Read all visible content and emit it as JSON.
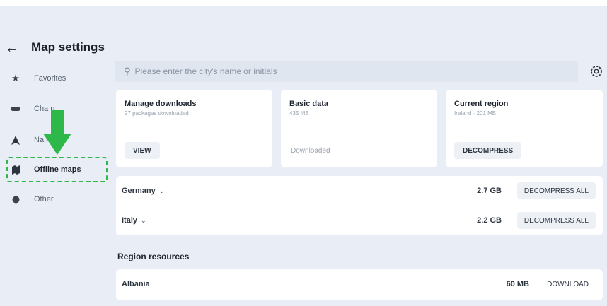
{
  "header": {
    "title": "Map settings"
  },
  "sidebar": {
    "items": [
      {
        "label": "Favorites",
        "icon": "star-icon"
      },
      {
        "label": "Cha  n",
        "icon": "car-icon"
      },
      {
        "label": "Na      n",
        "icon": "navigation-icon"
      },
      {
        "label": "Offline maps",
        "icon": "offline-maps-icon",
        "active": true
      },
      {
        "label": "Other",
        "icon": "dot-icon"
      }
    ]
  },
  "search": {
    "placeholder": "Please enter the city's name or initials"
  },
  "cards": [
    {
      "title": "Manage downloads",
      "subtitle": "27 packages downloaded",
      "button": "VIEW"
    },
    {
      "title": "Basic data",
      "subtitle": "435 MB",
      "status": "Downloaded"
    },
    {
      "title": "Current region",
      "subtitle": "Ireland · 201 MB",
      "button": "DECOMPRESS"
    }
  ],
  "downloaded": [
    {
      "name": "Germany",
      "size": "2.7 GB",
      "action": "DECOMPRESS ALL"
    },
    {
      "name": "Italy",
      "size": "2.2 GB",
      "action": "DECOMPRESS ALL"
    }
  ],
  "region_resources": {
    "title": "Region resources",
    "items": [
      {
        "name": "Albania",
        "size": "60 MB",
        "action": "DOWNLOAD"
      }
    ]
  },
  "colors": {
    "highlight": "#2eb84a",
    "background": "#e9eef6"
  }
}
